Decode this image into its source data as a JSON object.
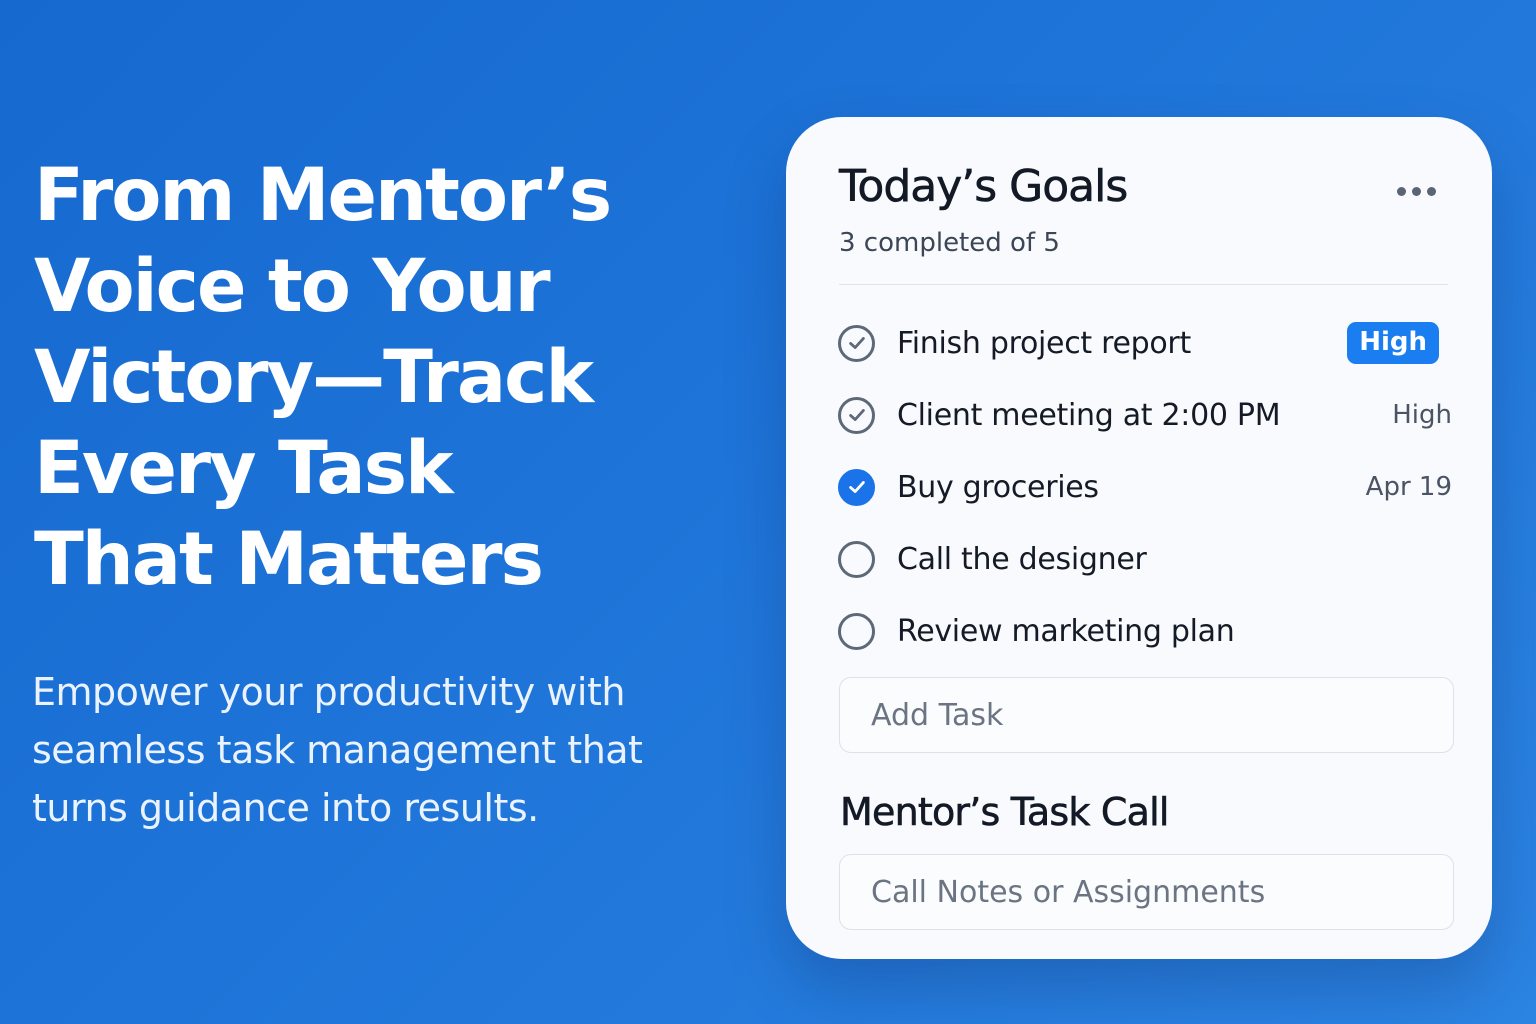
{
  "hero": {
    "title": "From Mentor’s Voice to Your Victory—Track Every Task That Matters",
    "subtitle": "Empower your productivity with seamless task management that turns guidance into results."
  },
  "card": {
    "title": "Today’s Goals",
    "progress_text": "3 completed of 5",
    "more_icon": "more-horizontal-icon",
    "tasks": [
      {
        "label": "Finish project report",
        "status": "completed",
        "meta": "High",
        "meta_style": "badge"
      },
      {
        "label": "Client meeting at 2:00 PM",
        "status": "completed",
        "meta": "High",
        "meta_style": "text"
      },
      {
        "label": "Buy groceries",
        "status": "checked",
        "meta": "Apr 19",
        "meta_style": "text"
      },
      {
        "label": "Call the designer",
        "status": "open",
        "meta": "",
        "meta_style": "none"
      },
      {
        "label": "Review marketing plan",
        "status": "open",
        "meta": "",
        "meta_style": "none"
      }
    ],
    "add_task_placeholder": "Add Task",
    "section_title": "Mentor’s Task Call",
    "notes_placeholder": "Call Notes or Assignments"
  },
  "colors": {
    "background": "#1e74d8",
    "accent": "#1a73e8",
    "card": "#f8fafd"
  }
}
